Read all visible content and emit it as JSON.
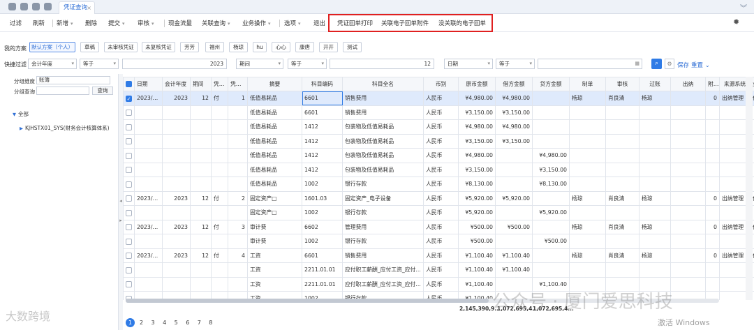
{
  "tabbar": {
    "active_tab": "凭证查询",
    "close": "×",
    "collapse": "︾"
  },
  "toolbar": {
    "items": [
      "过滤",
      "刷新",
      "新增",
      "删除",
      "提交",
      "审核",
      "现金流量",
      "关联查询",
      "业务操作",
      "选项",
      "退出",
      "凭证回单打印",
      "关联电子回单附件",
      "没关联的电子回单"
    ]
  },
  "scheme": {
    "label": "我的方案",
    "chips": [
      "默认方案（个人）",
      "草稿",
      "未审核凭证",
      "未复核凭证",
      "芳芳",
      "福州",
      "杨琼",
      "hu",
      "心心",
      "康唐",
      "开开",
      "测试"
    ]
  },
  "quickfilter": {
    "label": "快捷过滤",
    "f1": "会计年度",
    "op1": "等于",
    "v1": "2023",
    "f2": "期间",
    "op2": "等于",
    "v2": "12",
    "f3": "日期",
    "op3": "等于",
    "v3": "",
    "save": "保存",
    "reset": "重置"
  },
  "left": {
    "dim_label": "分组维度",
    "dim_value": "账簿",
    "query_label": "分组查询",
    "query_btn": "查询",
    "tree_root": "全部",
    "tree_child": "KJHSTX01_SYS(财务会计核算体系)"
  },
  "grid": {
    "headers": [
      "日期",
      "会计年度",
      "期间",
      "凭证字",
      "凭证号",
      "摘要",
      "科目编码",
      "科目全名",
      "币别",
      "原币金额",
      "借方金额",
      "贷方金额",
      "制单",
      "审核",
      "过账",
      "出纳",
      "附...",
      "来源系统",
      "业"
    ],
    "rows": [
      {
        "sel": true,
        "date": "2023/1...",
        "year": "2023",
        "period": "12",
        "word": "付",
        "no": "1",
        "summary": "低值易耗品",
        "code": "6601",
        "name": "销售费用",
        "cur": "人民币",
        "orig": "¥4,980.00",
        "debit": "¥4,980.00",
        "credit": "",
        "maker": "杨琼",
        "auditor": "肖良清",
        "poster": "杨琼",
        "cashier": "",
        "att": "0",
        "src": "出纳管理",
        "biz": "付"
      },
      {
        "sel": false,
        "date": "",
        "year": "",
        "period": "",
        "word": "",
        "no": "",
        "summary": "低值易耗品",
        "code": "6601",
        "name": "销售费用",
        "cur": "人民币",
        "orig": "¥3,150.00",
        "debit": "¥3,150.00",
        "credit": "",
        "maker": "",
        "auditor": "",
        "poster": "",
        "cashier": "",
        "att": "",
        "src": "",
        "biz": ""
      },
      {
        "sel": false,
        "date": "",
        "year": "",
        "period": "",
        "word": "",
        "no": "",
        "summary": "低值易耗品",
        "code": "1412",
        "name": "包装物及低值易耗品",
        "cur": "人民币",
        "orig": "¥4,980.00",
        "debit": "¥4,980.00",
        "credit": "",
        "maker": "",
        "auditor": "",
        "poster": "",
        "cashier": "",
        "att": "",
        "src": "",
        "biz": ""
      },
      {
        "sel": false,
        "date": "",
        "year": "",
        "period": "",
        "word": "",
        "no": "",
        "summary": "低值易耗品",
        "code": "1412",
        "name": "包装物及低值易耗品",
        "cur": "人民币",
        "orig": "¥3,150.00",
        "debit": "¥3,150.00",
        "credit": "",
        "maker": "",
        "auditor": "",
        "poster": "",
        "cashier": "",
        "att": "",
        "src": "",
        "biz": ""
      },
      {
        "sel": false,
        "date": "",
        "year": "",
        "period": "",
        "word": "",
        "no": "",
        "summary": "低值易耗品",
        "code": "1412",
        "name": "包装物及低值易耗品",
        "cur": "人民币",
        "orig": "¥4,980.00",
        "debit": "",
        "credit": "¥4,980.00",
        "maker": "",
        "auditor": "",
        "poster": "",
        "cashier": "",
        "att": "",
        "src": "",
        "biz": ""
      },
      {
        "sel": false,
        "date": "",
        "year": "",
        "period": "",
        "word": "",
        "no": "",
        "summary": "低值易耗品",
        "code": "1412",
        "name": "包装物及低值易耗品",
        "cur": "人民币",
        "orig": "¥3,150.00",
        "debit": "",
        "credit": "¥3,150.00",
        "maker": "",
        "auditor": "",
        "poster": "",
        "cashier": "",
        "att": "",
        "src": "",
        "biz": ""
      },
      {
        "sel": false,
        "date": "",
        "year": "",
        "period": "",
        "word": "",
        "no": "",
        "summary": "低值易耗品",
        "code": "1002",
        "name": "银行存款",
        "cur": "人民币",
        "orig": "¥8,130.00",
        "debit": "",
        "credit": "¥8,130.00",
        "maker": "",
        "auditor": "",
        "poster": "",
        "cashier": "",
        "att": "",
        "src": "",
        "biz": ""
      },
      {
        "sel": false,
        "date": "2023/1...",
        "year": "2023",
        "period": "12",
        "word": "付",
        "no": "2",
        "summary": "固定资产□",
        "code": "1601.03",
        "name": "固定资产_电子设备",
        "cur": "人民币",
        "orig": "¥5,920.00",
        "debit": "¥5,920.00",
        "credit": "",
        "maker": "杨琼",
        "auditor": "肖良清",
        "poster": "杨琼",
        "cashier": "",
        "att": "0",
        "src": "出纳管理",
        "biz": "付"
      },
      {
        "sel": false,
        "date": "",
        "year": "",
        "period": "",
        "word": "",
        "no": "",
        "summary": "固定资产□",
        "code": "1002",
        "name": "银行存款",
        "cur": "人民币",
        "orig": "¥5,920.00",
        "debit": "",
        "credit": "¥5,920.00",
        "maker": "",
        "auditor": "",
        "poster": "",
        "cashier": "",
        "att": "",
        "src": "",
        "biz": ""
      },
      {
        "sel": false,
        "date": "2023/1...",
        "year": "2023",
        "period": "12",
        "word": "付",
        "no": "3",
        "summary": "审计费",
        "code": "6602",
        "name": "管理费用",
        "cur": "人民币",
        "orig": "¥500.00",
        "debit": "¥500.00",
        "credit": "",
        "maker": "杨琼",
        "auditor": "肖良清",
        "poster": "杨琼",
        "cashier": "",
        "att": "0",
        "src": "出纳管理",
        "biz": "付"
      },
      {
        "sel": false,
        "date": "",
        "year": "",
        "period": "",
        "word": "",
        "no": "",
        "summary": "审计费",
        "code": "1002",
        "name": "银行存款",
        "cur": "人民币",
        "orig": "¥500.00",
        "debit": "",
        "credit": "¥500.00",
        "maker": "",
        "auditor": "",
        "poster": "",
        "cashier": "",
        "att": "",
        "src": "",
        "biz": ""
      },
      {
        "sel": false,
        "date": "2023/1...",
        "year": "2023",
        "period": "12",
        "word": "付",
        "no": "4",
        "summary": "工资",
        "code": "6601",
        "name": "销售费用",
        "cur": "人民币",
        "orig": "¥1,100.40",
        "debit": "¥1,100.40",
        "credit": "",
        "maker": "杨琼",
        "auditor": "肖良清",
        "poster": "杨琼",
        "cashier": "",
        "att": "0",
        "src": "出纳管理",
        "biz": "付"
      },
      {
        "sel": false,
        "date": "",
        "year": "",
        "period": "",
        "word": "",
        "no": "",
        "summary": "工资",
        "code": "2211.01.01",
        "name": "应付职工薪酬_应付工资_应付...",
        "cur": "人民币",
        "orig": "¥1,100.40",
        "debit": "¥1,100.40",
        "credit": "",
        "maker": "",
        "auditor": "",
        "poster": "",
        "cashier": "",
        "att": "",
        "src": "",
        "biz": ""
      },
      {
        "sel": false,
        "date": "",
        "year": "",
        "period": "",
        "word": "",
        "no": "",
        "summary": "工资",
        "code": "2211.01.01",
        "name": "应付职工薪酬_应付工资_应付...",
        "cur": "人民币",
        "orig": "¥1,100.40",
        "debit": "",
        "credit": "¥1,100.40",
        "maker": "",
        "auditor": "",
        "poster": "",
        "cashier": "",
        "att": "",
        "src": "",
        "biz": ""
      },
      {
        "sel": false,
        "date": "",
        "year": "",
        "period": "",
        "word": "",
        "no": "",
        "summary": "工资",
        "code": "1002",
        "name": "银行存款",
        "cur": "人民币",
        "orig": "¥1,100.40",
        "debit": "",
        "credit": "",
        "maker": "",
        "auditor": "",
        "poster": "",
        "cashier": "",
        "att": "",
        "src": "",
        "biz": ""
      }
    ]
  },
  "totals": {
    "orig": "2,145,390,9...",
    "debit": "1,072,695,4...",
    "credit": "1,072,695,4..."
  },
  "pager": [
    "1",
    "2",
    "3",
    "4",
    "5",
    "6",
    "7",
    "8"
  ],
  "watermarks": {
    "right": "公众号 · 厦门爱思科技",
    "left": "大数跨境",
    "windows": "激活 Windows"
  },
  "colors": {
    "accent": "#2f7be6",
    "highlight": "#e02020",
    "selected_row": "#dfeafc"
  }
}
